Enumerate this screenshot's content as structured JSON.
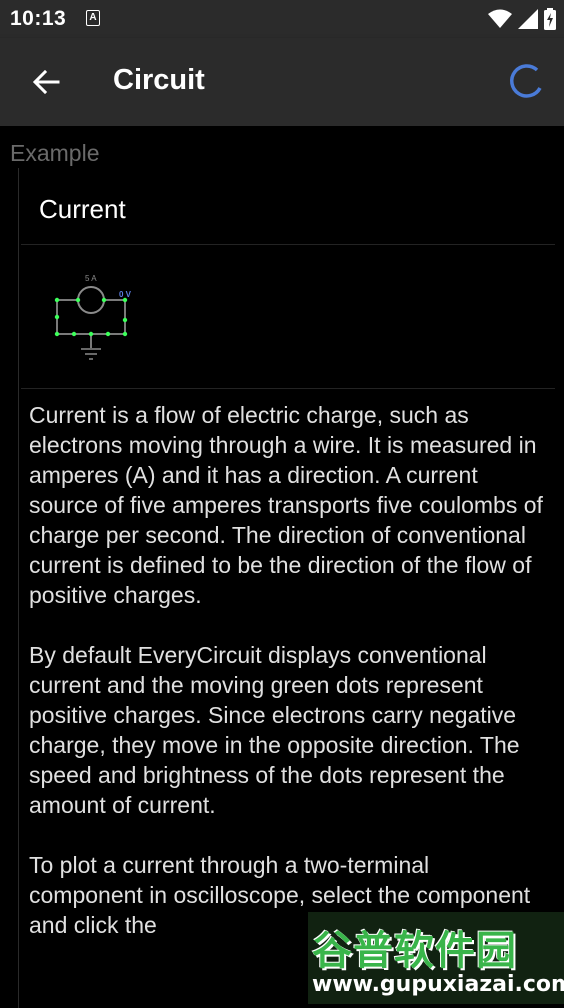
{
  "status_bar": {
    "time": "10:13",
    "notification_letter": "A"
  },
  "app_bar": {
    "title": "Circuit",
    "back_icon": "arrow-left-icon",
    "loading_icon": "spinner-icon",
    "accent": "#4a7bd8"
  },
  "section": {
    "label": "Example"
  },
  "card": {
    "title": "Current",
    "circuit": {
      "current_label": "5 A",
      "voltage_label": "0 V",
      "wire_color": "#7a7a7a",
      "dot_color": "#3cff5a",
      "voltage_color": "#5b7de0"
    },
    "paragraphs": [
      "Current is a flow of electric charge, such as electrons moving through a wire. It is measured in amperes (A) and it has a direction. A current source of five amperes transports five coulombs of charge per second. The direction of conventional current is defined to be the direction of the flow of positive charges.",
      "By default EveryCircuit displays conventional current and the moving green dots represent positive charges. Since electrons carry negative charge, they move in the opposite direction. The speed and brightness of the dots represent the amount of current.",
      "To plot a current through a two-terminal component in oscilloscope, select the component and click the"
    ]
  },
  "watermark": {
    "title": "谷普软件园",
    "url": "www.gupuxiazai.com"
  }
}
